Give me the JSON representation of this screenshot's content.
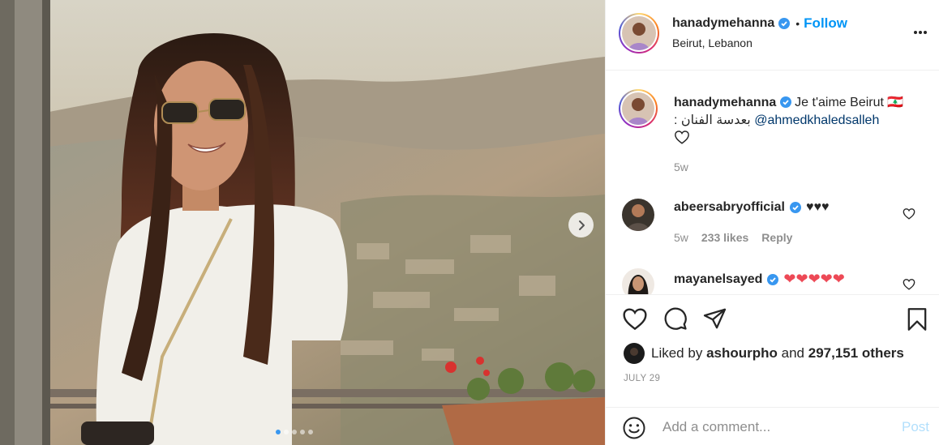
{
  "post": {
    "username": "hanadymehanna",
    "follow_separator": "•",
    "follow_label": "Follow",
    "location": "Beirut, Lebanon",
    "carousel_total_dots": 5,
    "carousel_active_index": 0
  },
  "caption": {
    "username": "hanadymehanna",
    "text_main": "Je t'aime Beirut 🇱🇧",
    "text_arabic": "بعدسة الفنان :",
    "mention": "@ahmedkhaledsalleh",
    "timestamp": "5w"
  },
  "comments": [
    {
      "username": "abeersabryofficial",
      "text": "♥♥♥",
      "timestamp": "5w",
      "likes": "233 likes",
      "reply_label": "Reply"
    },
    {
      "username": "mayanelsayed",
      "text": "❤❤❤❤❤"
    }
  ],
  "likes": {
    "prefix": "Liked by",
    "user": "ashourpho",
    "connector": "and",
    "count": "297,151 others"
  },
  "date": "JULY 29",
  "add_comment": {
    "placeholder": "Add a comment...",
    "post_label": "Post"
  },
  "colors": {
    "accent": "#0095f6",
    "post_disabled": "#b2dffc",
    "muted": "#8e8e8e",
    "verified": "#3897f0",
    "heart_red": "#ed4956"
  }
}
